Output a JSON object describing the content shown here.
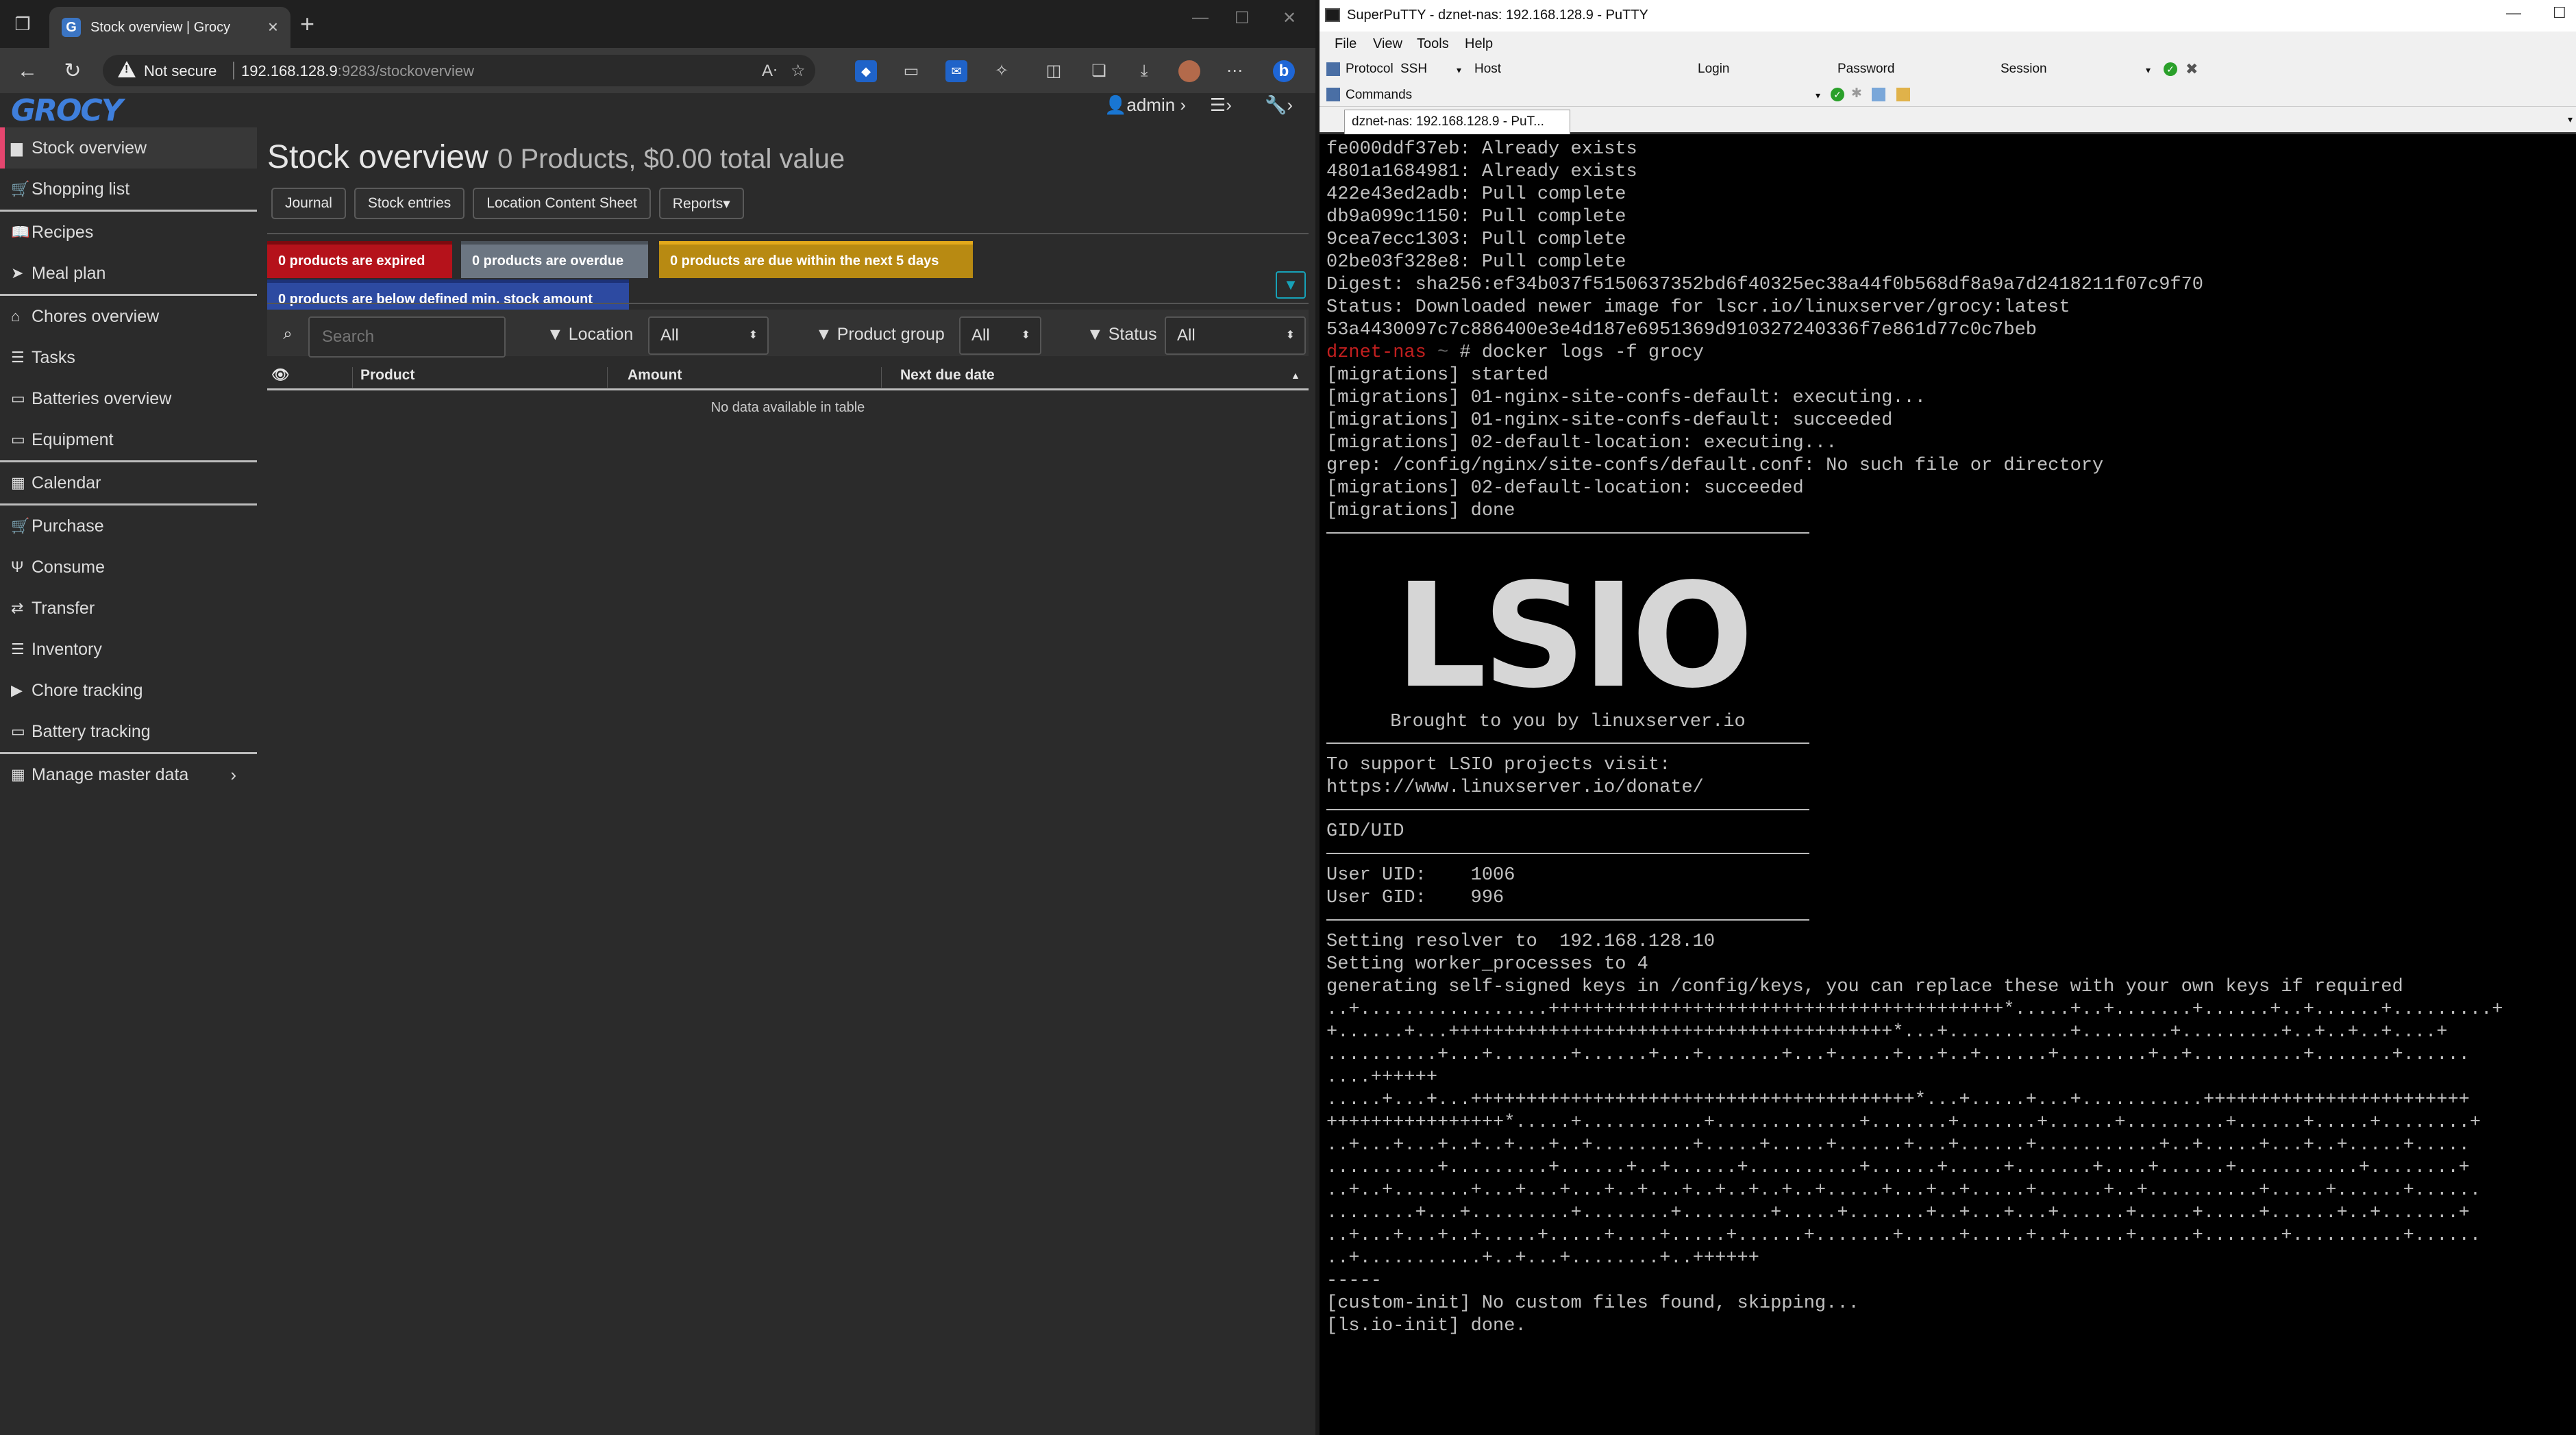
{
  "browser": {
    "tab_title": "Stock overview | Grocy",
    "tab_favicon": "G",
    "url_security": "Not secure",
    "url_host": "192.168.128.9",
    "url_path": ":9283/stockoverview"
  },
  "grocy": {
    "logo": "GROCY",
    "user": "admin",
    "sidebar": [
      {
        "label": "Stock overview",
        "icon": "box-icon",
        "glyph": "▆",
        "active": true
      },
      {
        "label": "Shopping list",
        "icon": "cart-icon",
        "glyph": "🛒"
      },
      {
        "sep": true
      },
      {
        "label": "Recipes",
        "icon": "cookbook-icon",
        "glyph": "📖"
      },
      {
        "label": "Meal plan",
        "icon": "paper-plane-icon",
        "glyph": "➤"
      },
      {
        "sep": true
      },
      {
        "label": "Chores overview",
        "icon": "home-icon",
        "glyph": "⌂"
      },
      {
        "label": "Tasks",
        "icon": "tasks-icon",
        "glyph": "☰"
      },
      {
        "label": "Batteries overview",
        "icon": "battery-icon",
        "glyph": "▭"
      },
      {
        "label": "Equipment",
        "icon": "equipment-icon",
        "glyph": "▭"
      },
      {
        "sep": true
      },
      {
        "label": "Calendar",
        "icon": "calendar-icon",
        "glyph": "▦"
      },
      {
        "sep": true
      },
      {
        "label": "Purchase",
        "icon": "cart-plus-icon",
        "glyph": "🛒"
      },
      {
        "label": "Consume",
        "icon": "utensils-icon",
        "glyph": "Ψ"
      },
      {
        "label": "Transfer",
        "icon": "exchange-icon",
        "glyph": "⇄"
      },
      {
        "label": "Inventory",
        "icon": "list-icon",
        "glyph": "☰"
      },
      {
        "label": "Chore tracking",
        "icon": "play-icon",
        "glyph": "▶"
      },
      {
        "label": "Battery tracking",
        "icon": "battery-icon",
        "glyph": "▭"
      },
      {
        "sep": true
      },
      {
        "label": "Manage master data",
        "icon": "table-icon",
        "glyph": "▦",
        "chevron": true
      }
    ],
    "page_title": "Stock overview",
    "page_subtitle": "0 Products, $0.00 total value",
    "buttons": [
      "Journal",
      "Stock entries",
      "Location Content Sheet",
      "Reports▾"
    ],
    "badges": {
      "expired": "0 products are expired",
      "overdue": "0 products are overdue",
      "due": "0 products are due within the next 5 days",
      "below": "0 products are below defined min. stock amount"
    },
    "search_placeholder": "Search",
    "filters": {
      "location_label": "Location",
      "location_value": "All",
      "group_label": "Product group",
      "group_value": "All",
      "status_label": "Status",
      "status_value": "All"
    },
    "table": {
      "columns": [
        "Product",
        "Amount",
        "Next due date"
      ],
      "empty": "No data available in table"
    }
  },
  "putty": {
    "window_title": "SuperPuTTY - dznet-nas: 192.168.128.9 - PuTTY",
    "menu": [
      "File",
      "View",
      "Tools",
      "Help"
    ],
    "toolbar": {
      "protocol_label": "Protocol",
      "protocol_value": "SSH",
      "host_label": "Host",
      "login_label": "Login",
      "password_label": "Password",
      "session_label": "Session",
      "commands_label": "Commands"
    },
    "tab": "dznet-nas: 192.168.128.9 - PuT...",
    "terminal_top": [
      "fe000ddf37eb: Already exists",
      "4801a1684981: Already exists",
      "422e43ed2adb: Pull complete",
      "db9a099c1150: Pull complete",
      "9cea7ecc1303: Pull complete",
      "02be03f328e8: Pull complete",
      "Digest: sha256:ef34b037f5150637352bd6f40325ec38a44f0b568df8a9a7d2418211f07c9f70",
      "Status: Downloaded newer image for lscr.io/linuxserver/grocy:latest",
      "53a4430097c7c886400e3e4d187e6951369d910327240336f7e861d77c0c7beb"
    ],
    "prompt_host": "dznet-nas",
    "prompt_path": "~",
    "prompt_cmd": "# docker logs -f grocy",
    "terminal_mid": [
      "[migrations] started",
      "[migrations] 01-nginx-site-confs-default: executing...",
      "[migrations] 01-nginx-site-confs-default: succeeded",
      "[migrations] 02-default-location: executing...",
      "grep: /config/nginx/site-confs/default.conf: No such file or directory",
      "[migrations] 02-default-location: succeeded",
      "[migrations] done"
    ],
    "lsio_logo": "LSIO",
    "lsio_caption": "Brought to you by linuxserver.io",
    "support_lines": [
      "To support LSIO projects visit:",
      "https://www.linuxserver.io/donate/"
    ],
    "gid_header": "GID/UID",
    "uid_lines": [
      "User UID:    1006",
      "User GID:    996"
    ],
    "terminal_bottom": [
      "Setting resolver to  192.168.128.10",
      "Setting worker_processes to 4",
      "generating self-signed keys in /config/keys, you can replace these with your own keys if required",
      "..+.................+++++++++++++++++++++++++++++++++++++++++*.....+..+.......+......+..+......+.........+",
      "+......+...++++++++++++++++++++++++++++++++++++++++*...+...........+........+.........+..+..+..+....+",
      "..........+...+.......+......+...+.......+...+.....+...+..+......+........+..+..........+.......+......",
      "....++++++",
      ".....+...+...++++++++++++++++++++++++++++++++++++++++*...+.....+...+...........++++++++++++++++++++++++",
      "++++++++++++++++*.....+...........+.............+.......+.......+......+.........+......+.....+........+",
      "..+...+...+..+..+...+..+.........+.....+.....+......+...+......+...........+..+.....+...+..+.....+.....",
      "..........+.........+......+..+......+..........+......+.....+.......+....+......+...........+........+",
      "..+..+.......+...+...+...+..+...+..+..+..+..+.....+...+..+.....+......+..+..........+.....+......+......",
      "........+...+.........+........+........+.....+.......+..+...+...+......+.....+.....+......+..+.......+",
      "..+...+...+..+.....+.....+....+.....+......+.......+.....+.....+..+.....+.....+.......+..........+......",
      "..+...........+..+...+........+..++++++",
      "-----",
      "[custom-init] No custom files found, skipping...",
      "[ls.io-init] done."
    ]
  }
}
